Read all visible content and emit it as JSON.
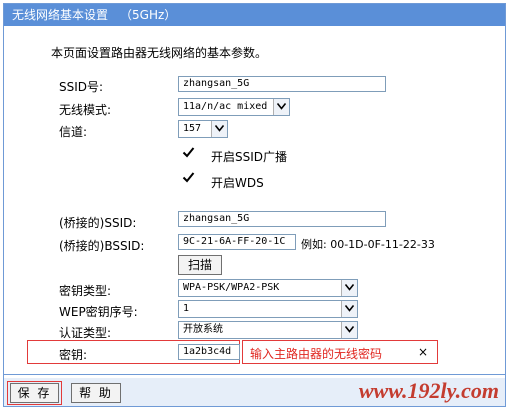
{
  "header": {
    "title": "无线网络基本设置",
    "subtitle": "（5GHz）"
  },
  "description": "本页面设置路由器无线网络的基本参数。",
  "form": {
    "ssid": {
      "label": "SSID号:",
      "value": "zhangsan_5G"
    },
    "mode": {
      "label": "无线模式:",
      "value": "11a/n/ac mixed"
    },
    "channel": {
      "label": "信道:",
      "value": "157"
    },
    "ssid_broadcast": {
      "label": "开启SSID广播",
      "checked": true
    },
    "wds": {
      "label": "开启WDS",
      "checked": true
    },
    "bridged_ssid": {
      "label": "(桥接的)SSID:",
      "value": "zhangsan_5G"
    },
    "bridged_bssid": {
      "label": "(桥接的)BSSID:",
      "value": "9C-21-6A-FF-20-1C",
      "example": "例如: 00-1D-0F-11-22-33"
    },
    "scan_label": "扫描",
    "key_type": {
      "label": "密钥类型:",
      "value": "WPA-PSK/WPA2-PSK"
    },
    "wep_index": {
      "label": "WEP密钥序号:",
      "value": "1"
    },
    "auth_type": {
      "label": "认证类型:",
      "value": "开放系统"
    },
    "key": {
      "label": "密钥:",
      "value": "1a2b3c4d",
      "hint": "输入主路由器的无线密码",
      "close": "×"
    }
  },
  "footer": {
    "save_label": "保 存",
    "help_label": "帮 助"
  },
  "watermark": "www.192ly.com",
  "colors": {
    "title_bar": "#5a8fd8",
    "highlight": "#e23a3a",
    "hint_text": "#e0261f"
  }
}
